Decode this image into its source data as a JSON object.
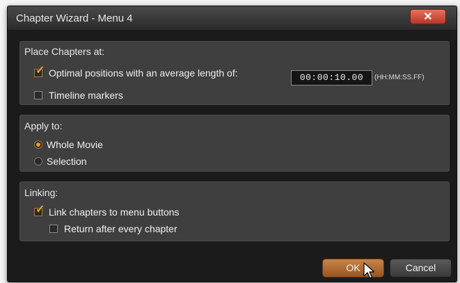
{
  "window": {
    "title": "Chapter Wizard - Menu 4",
    "close_glyph": "✕"
  },
  "place_chapters": {
    "title": "Place Chapters at:",
    "optimal_label": "Optimal positions with an average length of:",
    "optimal_checked": true,
    "time_value": "00:00:10.00",
    "time_format": "(HH:MM:SS.FF)",
    "timeline_markers_label": "Timeline markers",
    "timeline_markers_checked": false
  },
  "apply_to": {
    "title": "Apply to:",
    "options": [
      "Whole Movie",
      "Selection"
    ],
    "selected": "Whole Movie"
  },
  "linking": {
    "title": "Linking:",
    "link_label": "Link chapters to menu buttons",
    "link_checked": true,
    "return_label": "Return after every chapter",
    "return_checked": false
  },
  "buttons": {
    "ok": "OK",
    "cancel": "Cancel"
  },
  "colors": {
    "accent": "#f29a2e",
    "ok_button": "#b36b32",
    "close_button": "#c9473a"
  }
}
